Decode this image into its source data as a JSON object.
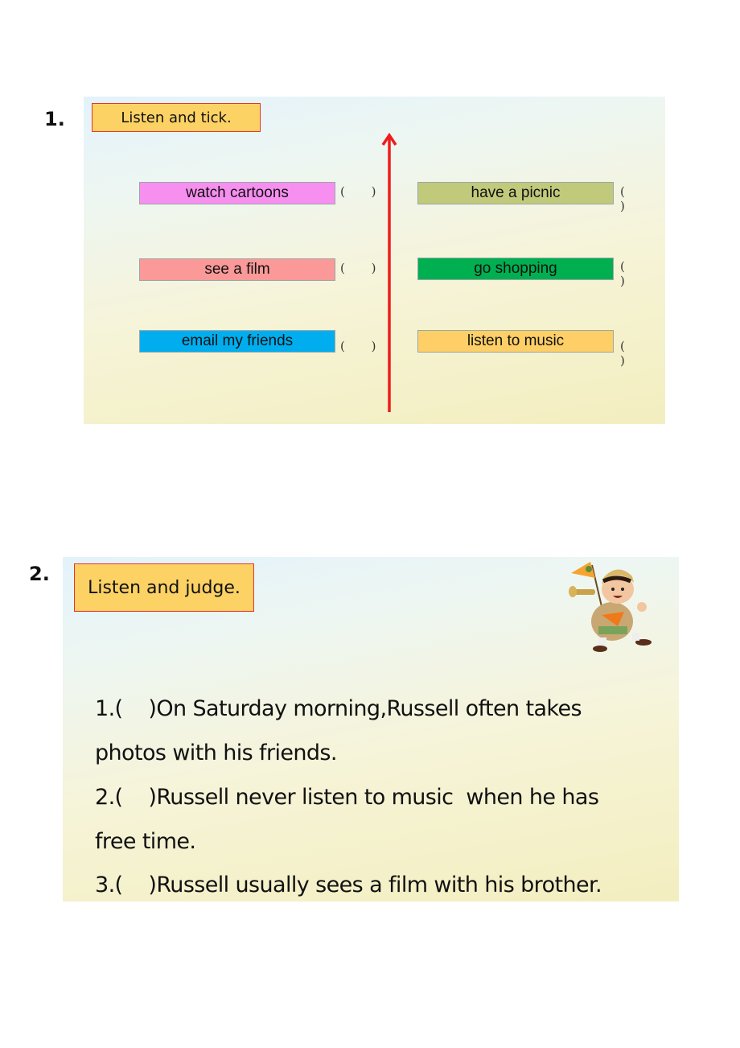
{
  "section1": {
    "number": "1.",
    "title": "Listen and tick.",
    "items_left": [
      {
        "label": "watch cartoons",
        "color": "#f78ff0",
        "answer": "(   )"
      },
      {
        "label": "see a film",
        "color": "#fb9999",
        "answer": "(   )"
      },
      {
        "label": "email my friends",
        "color": "#00aeef",
        "answer": "(   )"
      }
    ],
    "items_right": [
      {
        "label": "have a picnic",
        "color": "#c1c97b",
        "answer": "(   )"
      },
      {
        "label": "go shopping",
        "color": "#00af50",
        "answer": "(   )"
      },
      {
        "label": "listen to music",
        "color": "#fecf67",
        "answer": "(   )"
      }
    ],
    "arrow_color": "#ee1c1c"
  },
  "section2": {
    "number": "2.",
    "title": "Listen and judge.",
    "illustration": "russell-character-with-flag-and-trumpet",
    "statements": [
      "1.(    )On Saturday morning,Russell often takes",
      "photos with his friends.",
      "2.(    )Russell never listen to music  when he has",
      "free time.",
      "3.(    )Russell usually sees a film with his brother."
    ]
  }
}
